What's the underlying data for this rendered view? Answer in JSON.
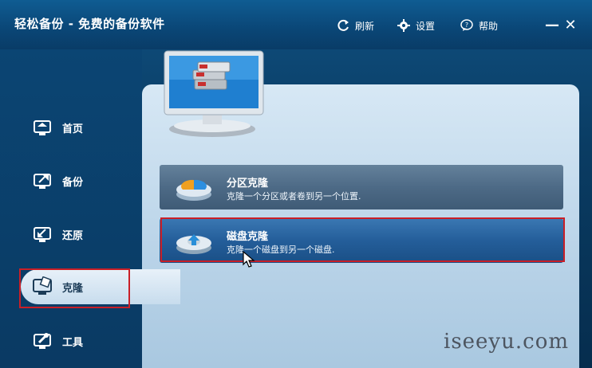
{
  "app": {
    "title": "轻松备份 - 免费的备份软件"
  },
  "toolbar": {
    "refresh_label": "刷新",
    "settings_label": "设置",
    "help_label": "帮助",
    "minimize_symbol": "—",
    "close_symbol": "✕"
  },
  "sidebar": {
    "items": [
      {
        "label": "首页",
        "icon": "home-icon"
      },
      {
        "label": "备份",
        "icon": "backup-icon"
      },
      {
        "label": "还原",
        "icon": "restore-icon"
      },
      {
        "label": "克隆",
        "icon": "clone-icon",
        "active": true
      },
      {
        "label": "工具",
        "icon": "tools-icon"
      }
    ]
  },
  "options": [
    {
      "title": "分区克隆",
      "desc": "克隆一个分区或者卷到另一个位置.",
      "icon": "partition-clone-icon"
    },
    {
      "title": "磁盘克隆",
      "desc": "克隆一个磁盘到另一个磁盘.",
      "icon": "disk-clone-icon",
      "highlighted": true
    }
  ],
  "watermark": "iseeyu.com",
  "colors": {
    "highlight_box": "#c91f27",
    "title_bar": "#0b4a7a",
    "panel": "#c4dbed"
  }
}
